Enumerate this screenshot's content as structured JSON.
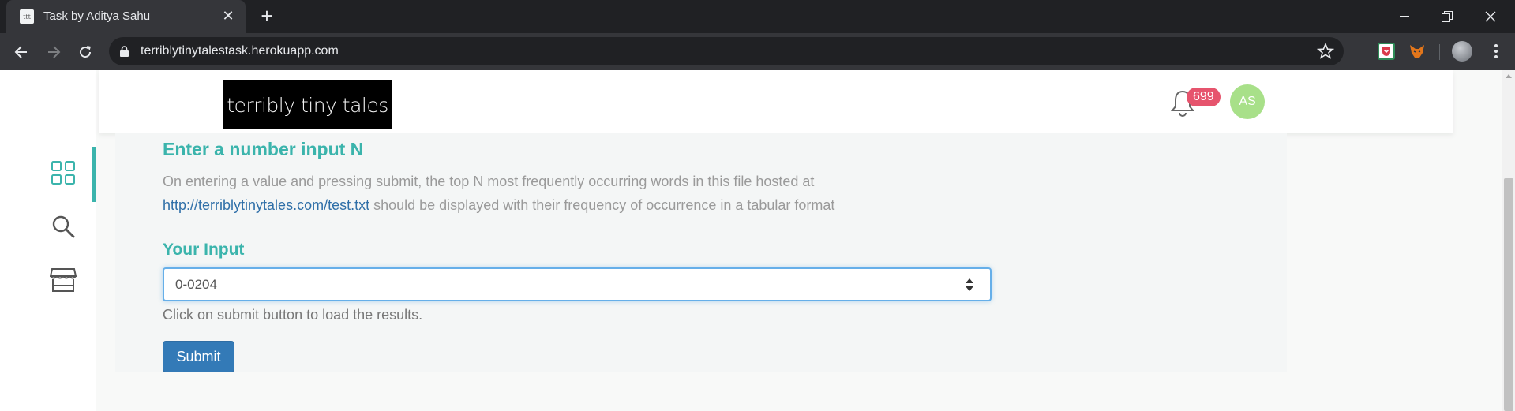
{
  "browser": {
    "tab_title": "Task by Aditya Sahu",
    "url": "terriblytinytalestask.herokuapp.com",
    "favicon_text": "ttt"
  },
  "header": {
    "logo_text": "terribly tiny tales",
    "notification_count": "699",
    "avatar_initials": "AS"
  },
  "sidebar": {
    "items": [
      {
        "icon": "grid-icon",
        "active": true
      },
      {
        "icon": "search-icon",
        "active": false
      },
      {
        "icon": "store-icon",
        "active": false
      }
    ]
  },
  "main": {
    "heading": "Enter a number input N",
    "description_text": "On entering a value and pressing submit, the top N most frequently occurring words in this file hosted at",
    "description_link": "http://terriblytinytales.com/test.txt",
    "description_tail": " should be displayed with their frequency of occurrence in a tabular format",
    "input_label": "Your Input",
    "input_value": "0-0204",
    "hint": "Click on submit button to load the results.",
    "submit_label": "Submit"
  },
  "colors": {
    "accent": "#3bb4ac",
    "primary_button": "#337ab7",
    "badge": "#e6546d",
    "avatar": "#a8e089"
  }
}
